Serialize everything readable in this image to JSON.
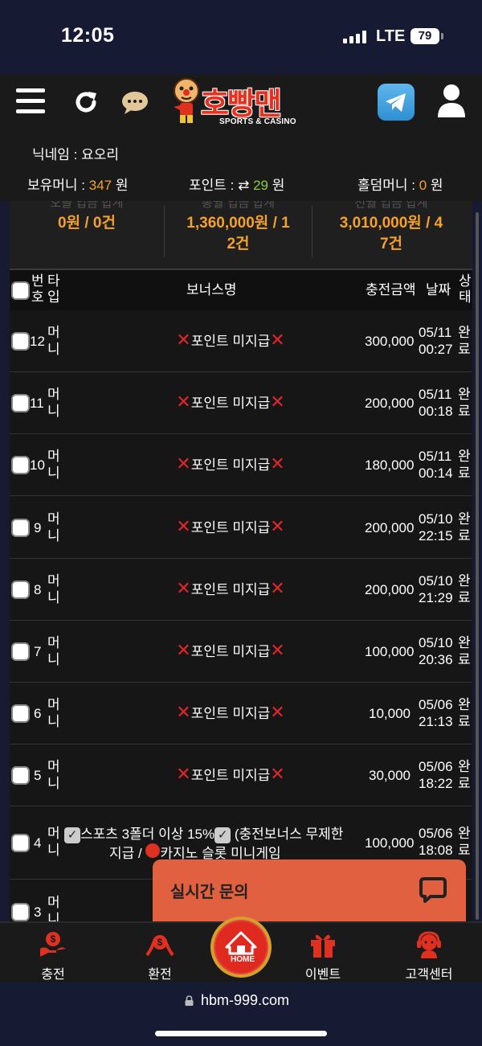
{
  "status_bar": {
    "time": "12:05",
    "network": "LTE",
    "battery": "79"
  },
  "header": {
    "logo_text": "호빵맨",
    "logo_sub": "SPORTS & CASINO"
  },
  "account": {
    "nickname_label": "닉네임 : 요오리",
    "holding_label": "보유머니 : ",
    "holding_value": "347",
    "holding_unit": " 원",
    "point_label": "포인트 : ",
    "point_icon": "⇄",
    "point_value": "29",
    "point_unit": " 원",
    "holdem_label": "홀덤머니 : ",
    "holdem_value": "0",
    "holdem_unit": " 원"
  },
  "summary": [
    {
      "label": "오늘 입금 합계",
      "line1": "0원 / 0건",
      "line2": ""
    },
    {
      "label": "총월 입금 합계",
      "line1": "1,360,000원 / 1",
      "line2": "2건"
    },
    {
      "label": "전월 입금 합계",
      "line1": "3,010,000원 / 4",
      "line2": "7건"
    }
  ],
  "table": {
    "headers": {
      "num_1": "번",
      "num_2": "호",
      "type_1": "타",
      "type_2": "입",
      "bonus": "보너스명",
      "amount": "충전금액",
      "date": "날짜",
      "status_1": "상",
      "status_2": "태"
    },
    "rows": [
      {
        "num": "12",
        "type_1": "머",
        "type_2": "니",
        "bonus": "포인트 미지급",
        "amount": "300,000",
        "date_1": "05/11",
        "date_2": "00:27",
        "status_1": "완",
        "status_2": "료"
      },
      {
        "num": "11",
        "type_1": "머",
        "type_2": "니",
        "bonus": "포인트 미지급",
        "amount": "200,000",
        "date_1": "05/11",
        "date_2": "00:18",
        "status_1": "완",
        "status_2": "료"
      },
      {
        "num": "10",
        "type_1": "머",
        "type_2": "니",
        "bonus": "포인트 미지급",
        "amount": "180,000",
        "date_1": "05/11",
        "date_2": "00:14",
        "status_1": "완",
        "status_2": "료"
      },
      {
        "num": "9",
        "type_1": "머",
        "type_2": "니",
        "bonus": "포인트 미지급",
        "amount": "200,000",
        "date_1": "05/10",
        "date_2": "22:15",
        "status_1": "완",
        "status_2": "료"
      },
      {
        "num": "8",
        "type_1": "머",
        "type_2": "니",
        "bonus": "포인트 미지급",
        "amount": "200,000",
        "date_1": "05/10",
        "date_2": "21:29",
        "status_1": "완",
        "status_2": "료"
      },
      {
        "num": "7",
        "type_1": "머",
        "type_2": "니",
        "bonus": "포인트 미지급",
        "amount": "100,000",
        "date_1": "05/10",
        "date_2": "20:36",
        "status_1": "완",
        "status_2": "료"
      },
      {
        "num": "6",
        "type_1": "머",
        "type_2": "니",
        "bonus": "포인트 미지급",
        "amount": "10,000",
        "date_1": "05/06",
        "date_2": "21:13",
        "status_1": "완",
        "status_2": "료"
      },
      {
        "num": "5",
        "type_1": "머",
        "type_2": "니",
        "bonus": "포인트 미지급",
        "amount": "30,000",
        "date_1": "05/06",
        "date_2": "18:22",
        "status_1": "완",
        "status_2": "료"
      }
    ],
    "row4": {
      "num": "4",
      "type_1": "머",
      "type_2": "니",
      "bonus_line1_a": "스포츠 3폴더 이상 15%",
      "bonus_line1_b": " (충전보너스 무제한",
      "bonus_line2_a": "지급 / ",
      "bonus_line2_b": "카지노 슬롯 미니게임",
      "amount": "100,000",
      "date_1": "05/06",
      "date_2": "18:08",
      "status_1": "완",
      "status_2": "료"
    },
    "row3": {
      "num": "3",
      "type_1": "머",
      "type_2": "니"
    }
  },
  "live_chat": {
    "label": "실시간 문의"
  },
  "bottom_nav": {
    "deposit": "충전",
    "withdraw": "환전",
    "home": "HOME",
    "event": "이벤트",
    "support": "고객센터"
  },
  "browser": {
    "url": "hbm-999.com"
  },
  "colors": {
    "accent": "#f6a12a",
    "green": "#8ccd3c",
    "danger": "#e0262a",
    "chat": "#e06040"
  }
}
